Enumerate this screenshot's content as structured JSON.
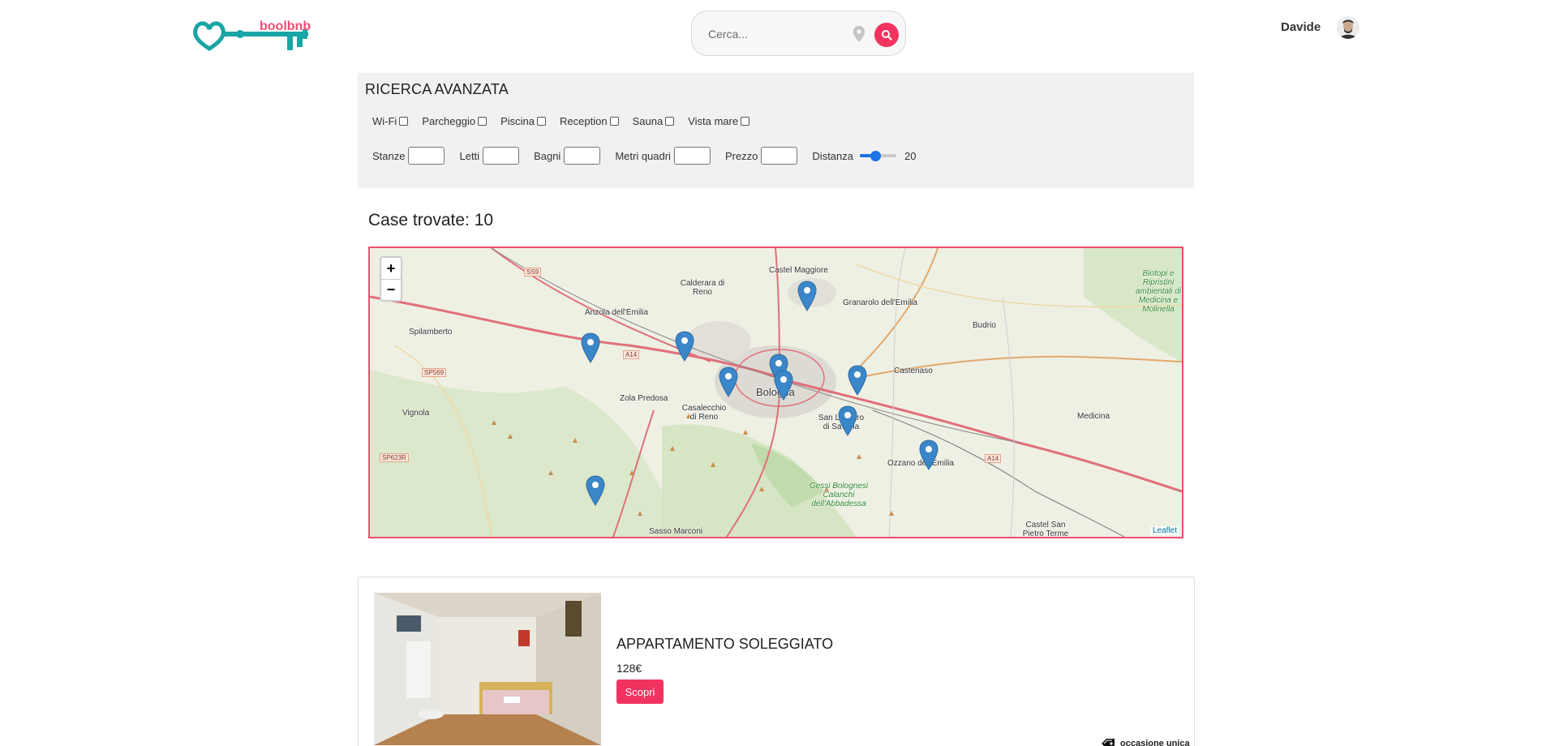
{
  "header": {
    "logo_text": "boolbnb",
    "search_placeholder": "Cerca...",
    "user_name": "Davide"
  },
  "advanced_search": {
    "title": "RICERCA AVANZATA",
    "services": [
      "Wi-Fi",
      "Parcheggio",
      "Piscina",
      "Reception",
      "Sauna",
      "Vista mare"
    ],
    "fields": {
      "rooms": "Stanze",
      "beds": "Letti",
      "baths": "Bagni",
      "sqm": "Metri quadri",
      "price": "Prezzo",
      "distance": "Distanza"
    },
    "distance_value": "20",
    "distance_fraction": 0.4
  },
  "results": {
    "found_label": "Case trovate: 10"
  },
  "map": {
    "zoom_in": "+",
    "zoom_out": "−",
    "attribution": "Leaflet",
    "places": [
      "Castel Maggiore",
      "Calderara di Reno",
      "Granarolo dell'Emilia",
      "Anzola dell'Emilia",
      "Spilamberto",
      "Budrio",
      "Castenaso",
      "Bologna",
      "Zola Predosa",
      "Casalecchio di Reno",
      "Vignola",
      "San Lazzaro di Savena",
      "Medicina",
      "Ozzano dell'Emilia",
      "Gessi Bolognesi Calanchi dell'Abbadessa",
      "Sasso Marconi",
      "Castel San Pietro Terme",
      "Biotopi e Ripristini ambientali di Medicina e Molinella"
    ],
    "roads": [
      "SS9",
      "A14",
      "SP569",
      "SP623R",
      "A14"
    ]
  },
  "listing": {
    "title": "APPARTAMENTO SOLEGGIATO",
    "price": "128€",
    "button": "Scopri",
    "badge": "occasione unica"
  },
  "colors": {
    "accent": "#f2335f",
    "brand_teal": "#1aa6a6",
    "panel_bg": "#f1f1f1",
    "marker_blue": "#3a86c8"
  }
}
